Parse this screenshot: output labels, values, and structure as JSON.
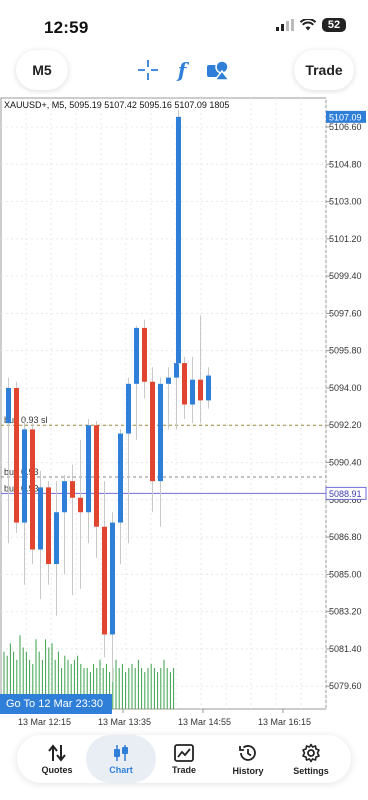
{
  "status": {
    "time": "12:59",
    "battery": "52"
  },
  "toolbar": {
    "timeframe_label": "M5",
    "trade_label": "Trade",
    "crosshair_icon": "crosshair-icon",
    "function_icon_glyph": "f",
    "objects_icon": "shapes-icon"
  },
  "chart": {
    "header": "XAUUSD+, M5, 5095.19 5107.42 5095.16 5107.09 1805",
    "price_labels": [
      "5106.60",
      "5104.80",
      "5103.00",
      "5101.20",
      "5099.40",
      "5097.60",
      "5095.80",
      "5094.00",
      "5092.20",
      "5090.40",
      "5088.60",
      "5086.80",
      "5085.00",
      "5083.20",
      "5081.40",
      "5079.60"
    ],
    "current_price": "5107.09",
    "bid_line_price": "5088.91",
    "time_labels": [
      "13 Mar 12:15",
      "13 Mar 13:35",
      "13 Mar 14:55",
      "13 Mar 16:15"
    ],
    "order_labels": [
      "buy 0.93 sl",
      "buy 0.93",
      "buy 0.93"
    ],
    "goto_label": "Go To 12 Mar 23:30",
    "colors": {
      "bull": "#2f7fd8",
      "bear": "#e2452f",
      "volume": "#3aa14a",
      "grid": "#e8e8e8"
    }
  },
  "chart_data": {
    "type": "candlestick",
    "symbol": "XAUUSD+",
    "timeframe": "M5",
    "ylim": [
      5078.5,
      5108.0
    ],
    "candles": [
      {
        "o": 5092.3,
        "h": 5094.5,
        "l": 5086.5,
        "c": 5094.0
      },
      {
        "o": 5094.0,
        "h": 5094.3,
        "l": 5087.0,
        "c": 5087.5
      },
      {
        "o": 5087.5,
        "h": 5092.5,
        "l": 5084.5,
        "c": 5092.0
      },
      {
        "o": 5092.0,
        "h": 5092.3,
        "l": 5085.5,
        "c": 5086.2
      },
      {
        "o": 5086.2,
        "h": 5090.0,
        "l": 5083.8,
        "c": 5089.2
      },
      {
        "o": 5089.2,
        "h": 5089.5,
        "l": 5084.5,
        "c": 5085.5
      },
      {
        "o": 5085.5,
        "h": 5089.5,
        "l": 5083.0,
        "c": 5088.0
      },
      {
        "o": 5088.0,
        "h": 5089.8,
        "l": 5085.0,
        "c": 5089.5
      },
      {
        "o": 5089.5,
        "h": 5090.3,
        "l": 5084.0,
        "c": 5088.7
      },
      {
        "o": 5088.7,
        "h": 5091.5,
        "l": 5084.3,
        "c": 5088.0
      },
      {
        "o": 5088.0,
        "h": 5092.5,
        "l": 5086.5,
        "c": 5092.2
      },
      {
        "o": 5092.2,
        "h": 5092.4,
        "l": 5085.8,
        "c": 5087.3
      },
      {
        "o": 5087.3,
        "h": 5089.5,
        "l": 5081.0,
        "c": 5082.1
      },
      {
        "o": 5082.1,
        "h": 5088.0,
        "l": 5079.8,
        "c": 5087.5
      },
      {
        "o": 5087.5,
        "h": 5092.0,
        "l": 5085.5,
        "c": 5091.8
      },
      {
        "o": 5091.8,
        "h": 5094.5,
        "l": 5086.5,
        "c": 5094.2
      },
      {
        "o": 5094.2,
        "h": 5097.0,
        "l": 5091.5,
        "c": 5096.9
      },
      {
        "o": 5096.9,
        "h": 5097.3,
        "l": 5093.5,
        "c": 5094.3
      },
      {
        "o": 5094.3,
        "h": 5095.0,
        "l": 5088.0,
        "c": 5089.5
      },
      {
        "o": 5089.5,
        "h": 5094.5,
        "l": 5087.3,
        "c": 5094.2
      },
      {
        "o": 5094.2,
        "h": 5095.0,
        "l": 5092.0,
        "c": 5094.5
      },
      {
        "o": 5094.5,
        "h": 5096.0,
        "l": 5092.0,
        "c": 5095.2
      },
      {
        "o": 5095.2,
        "h": 5095.5,
        "l": 5092.5,
        "c": 5093.2
      },
      {
        "o": 5093.2,
        "h": 5095.5,
        "l": 5092.3,
        "c": 5094.4
      },
      {
        "o": 5094.4,
        "h": 5097.5,
        "l": 5092.3,
        "c": 5093.4
      },
      {
        "o": 5093.4,
        "h": 5095.0,
        "l": 5093.0,
        "c": 5094.6
      },
      {
        "o": 5095.19,
        "h": 5107.42,
        "l": 5095.16,
        "c": 5107.09
      }
    ],
    "volumes": [
      0.7,
      0.65,
      0.8,
      0.7,
      0.6,
      0.9,
      0.75,
      0.7,
      0.6,
      0.55,
      0.85,
      0.7,
      0.6,
      0.85,
      0.75,
      0.8,
      0.6,
      0.7,
      0.5,
      0.65,
      0.6,
      0.55,
      0.6,
      0.65,
      0.55,
      0.5,
      0.5,
      0.45,
      0.55,
      0.5,
      0.6,
      0.5,
      0.55,
      0.45,
      0.5,
      0.6,
      0.5,
      0.55,
      0.45,
      0.5,
      0.55,
      0.5,
      0.6,
      0.5,
      0.45,
      0.5,
      0.55,
      0.5,
      0.45,
      0.5,
      0.6,
      0.5,
      0.45,
      0.5
    ],
    "levels": [
      {
        "name": "sl",
        "price": 5092.2,
        "style": "dashed",
        "color": "#9a8a3a"
      },
      {
        "name": "buy1",
        "price": 5089.7,
        "style": "dashed",
        "color": "#888888"
      },
      {
        "name": "buy2",
        "price": 5088.91,
        "style": "solid",
        "color": "#6f6fd8"
      }
    ]
  },
  "nav": {
    "items": [
      {
        "label": "Quotes",
        "icon": "quotes-arrows-icon"
      },
      {
        "label": "Chart",
        "icon": "candles-icon"
      },
      {
        "label": "Trade",
        "icon": "trade-chart-icon"
      },
      {
        "label": "History",
        "icon": "history-clock-icon"
      },
      {
        "label": "Settings",
        "icon": "gear-icon"
      }
    ]
  }
}
